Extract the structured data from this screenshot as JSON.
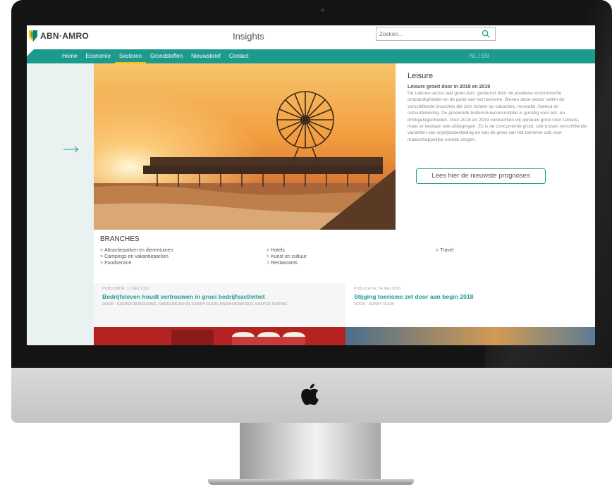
{
  "header": {
    "logo_text": "ABN·AMRO",
    "page_title": "Insights",
    "search_placeholder": "Zoeken..."
  },
  "nav": {
    "items": [
      "Home",
      "Economie",
      "Sectoren",
      "Grondstoffen",
      "Nieuwsbrief",
      "Contact"
    ],
    "active": "Sectoren",
    "language": "NL | EN"
  },
  "sector": {
    "title": "Leisure",
    "subtitle": "Leisure groeit door in 2018 en 2019",
    "body": "De Leisure-sector laat groei zien, gesteund door de positieve economische omstandigheden en de groei van het toerisme. Binnen deze sector vallen de verschillende branches die zich richten op vakanties, recreatie, horeca en cultuurbeleving. De groeiende buitenshuisconsumptie is gunstig voor eet- en drinkgelegenheden. Voor 2018 en 2019 verwachten wij opnieuw groei voor Leisure, maar er bestaan ook uitdagingen. Zo is de concurrentie groot, ook tussen verschillende varianten van vrijetijdsbesteding en kan de groei van het toerisme ook voor maatschappelijke onrede zorgen.",
    "cta_label": "Lees hier de nieuwste prognoses"
  },
  "branches": {
    "title": "BRANCHES",
    "col1": [
      "Attractieparken en dierentuinen",
      "Campings en vakantieparken",
      "Foodservice"
    ],
    "col2": [
      "Hotels",
      "Kunst en cultuur",
      "Restaurants"
    ],
    "col3": [
      "Travel"
    ]
  },
  "articles": [
    {
      "date": "PUBLICATIE: 17 MEI 2018",
      "title": "Bedrijfsleven houdt vertrouwen in groei bedrijfsactiviteit",
      "authors": "DOOR : CASPER BURGERING, MADELINE BUIJS, SONNY DUIJN, NADIA MENKVELD, KASPER SUITING"
    },
    {
      "date": "PUBLICATIE: 04 MEI 2018",
      "title": "Stijging toerisme zet door aan begin 2018",
      "authors": "DOOR : SONNY DUIJN"
    }
  ],
  "colors": {
    "brand_teal": "#1c9a8d",
    "nav_active_underline": "#f2c400",
    "logo_green": "#00857a",
    "logo_yellow": "#f2c400"
  },
  "icons": [
    "abn-amro-shield-icon",
    "search-icon",
    "arrow-right-icon",
    "chevron-right-icon",
    "apple-logo-icon"
  ]
}
